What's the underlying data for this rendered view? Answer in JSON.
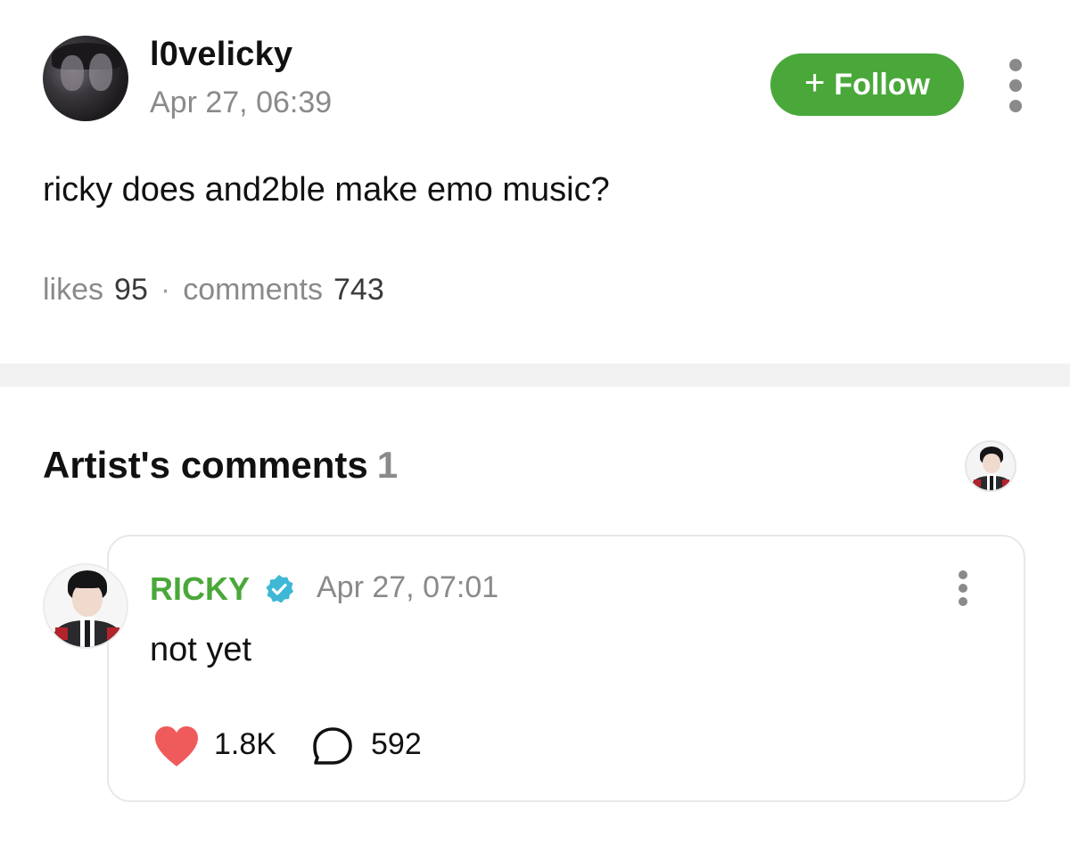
{
  "post": {
    "author": "l0velicky",
    "time": "Apr 27, 06:39",
    "follow_label": "Follow",
    "body": "ricky does and2ble make emo music?",
    "likes_label": "likes",
    "likes_count": "95",
    "separator": "·",
    "comments_label": "comments",
    "comments_count": "743"
  },
  "artist_comments": {
    "title": "Artist's comments",
    "count": "1",
    "comment": {
      "author": "RICKY",
      "verified": true,
      "time": "Apr 27, 07:01",
      "text": "not yet",
      "likes": "1.8K",
      "replies": "592"
    }
  },
  "colors": {
    "accent_green": "#4aa83a",
    "heart_red": "#ef5b5b",
    "verified_blue": "#3fb7d6",
    "muted_gray": "#8a8a8a"
  },
  "icons": [
    "plus-icon",
    "more-vertical-icon",
    "verified-badge-icon",
    "heart-icon",
    "comment-bubble-icon"
  ]
}
